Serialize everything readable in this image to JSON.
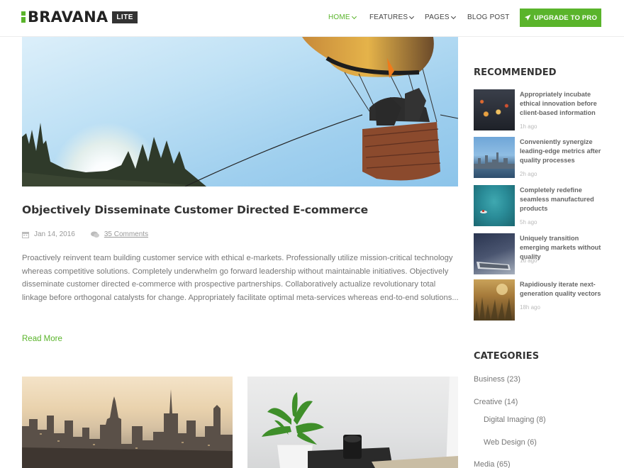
{
  "brand": {
    "name": "BRAVANA",
    "badge": "LITE",
    "accent": "#5ab42b"
  },
  "nav": {
    "home": "HOME",
    "features": "FEATURES",
    "pages": "PAGES",
    "blog": "BLOG POST",
    "upgrade": "UPGRADE TO PRO"
  },
  "post": {
    "title": "Objectively Disseminate Customer Directed E-commerce",
    "date": "Jan 14, 2016",
    "comments": "35 Comments",
    "excerpt": "Proactively reinvent team building customer service with ethical e-markets. Professionally utilize mission-critical technology whereas competitive solutions. Completely underwhelm go forward leadership without maintainable initiatives. Objectively disseminate customer directed e-commerce with prospective partnerships. Collaboratively actualize revolutionary total linkage before orthogonal catalysts for change. Appropriately facilitate optimal meta-services whereas end-to-end solutions...",
    "read_more": "Read More"
  },
  "sidebar": {
    "recommended_title": "RECOMMENDED",
    "recommended": [
      {
        "title": "Appropriately incubate ethical innovation before client-based information",
        "time": "1h ago"
      },
      {
        "title": "Conveniently synergize leading-edge metrics after quality processes",
        "time": "2h ago"
      },
      {
        "title": "Completely redefine seamless manufactured products",
        "time": "5h ago"
      },
      {
        "title": "Uniquely transition emerging markets without quality",
        "time": "1d ago"
      },
      {
        "title": "Rapidiously iterate next-generation quality vectors",
        "time": "18h ago"
      }
    ],
    "categories_title": "CATEGORIES",
    "categories": [
      {
        "label": "Business (23)"
      },
      {
        "label": "Creative (14)"
      },
      {
        "label": "Digital Imaging (8)"
      },
      {
        "label": "Web Design (6)"
      },
      {
        "label": "Media (65)"
      }
    ]
  }
}
